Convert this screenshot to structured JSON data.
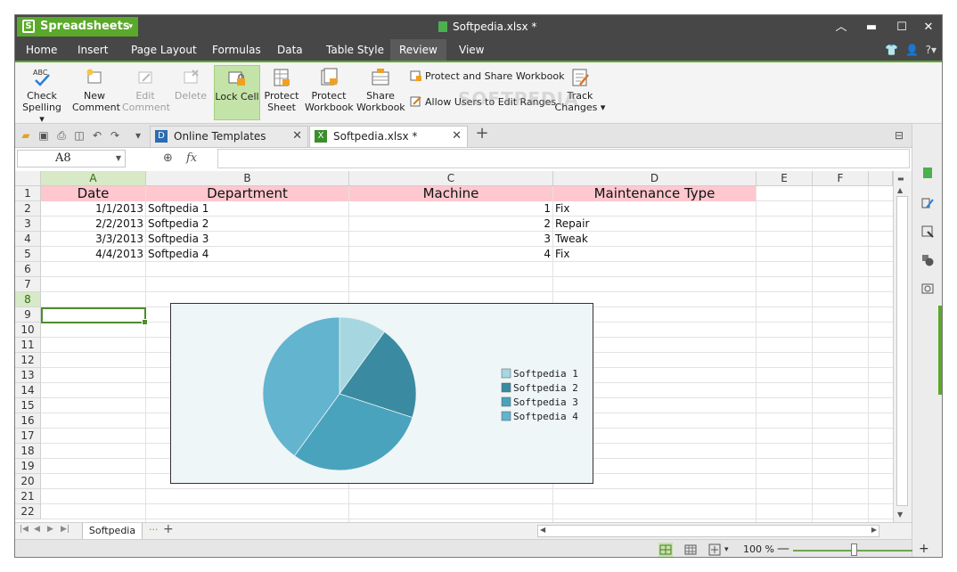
{
  "titlebar": {
    "app_name": "Spreadsheets",
    "doc_title": "Softpedia.xlsx *"
  },
  "menu": [
    "Home",
    "Insert",
    "Page Layout",
    "Formulas",
    "Data",
    "Table Style",
    "Review",
    "View"
  ],
  "menu_active": "Review",
  "ribbon": {
    "check_spelling_1": "Check",
    "check_spelling_2": "Spelling",
    "new_comment_1": "New",
    "new_comment_2": "Comment",
    "edit_comment_1": "Edit",
    "edit_comment_2": "Comment",
    "delete": "Delete",
    "lock_cell": "Lock Cell",
    "protect_sheet_1": "Protect",
    "protect_sheet_2": "Sheet",
    "protect_workbook_1": "Protect",
    "protect_workbook_2": "Workbook",
    "share_workbook_1": "Share",
    "share_workbook_2": "Workbook",
    "protect_share": "Protect and Share Workbook",
    "allow_users": "Allow Users to Edit Ranges",
    "track_changes_1": "Track",
    "track_changes_2": "Changes",
    "watermark": "SOFTPEDIA"
  },
  "tabs": {
    "online_templates": "Online Templates",
    "doc": "Softpedia.xlsx *"
  },
  "formula_bar": {
    "name_box": "A8",
    "fx": "fx",
    "value": ""
  },
  "columns": [
    "A",
    "B",
    "C",
    "D",
    "E",
    "F"
  ],
  "rows": [
    "1",
    "2",
    "3",
    "4",
    "5",
    "6",
    "7",
    "8",
    "9",
    "10",
    "11",
    "12",
    "13",
    "14",
    "15",
    "16",
    "17",
    "18",
    "19",
    "20",
    "21",
    "22"
  ],
  "header_row": {
    "a": "Date",
    "b": "Department",
    "c": "Machine",
    "d": "Maintenance Type"
  },
  "data_rows": [
    {
      "date": "1/1/2013",
      "dept": "Softpedia 1",
      "machine": "1",
      "type": "Fix"
    },
    {
      "date": "2/2/2013",
      "dept": "Softpedia 2",
      "machine": "2",
      "type": "Repair"
    },
    {
      "date": "3/3/2013",
      "dept": "Softpedia 3",
      "machine": "3",
      "type": "Tweak"
    },
    {
      "date": "4/4/2013",
      "dept": "Softpedia 4",
      "machine": "4",
      "type": "Fix"
    }
  ],
  "chart_data": {
    "type": "pie",
    "categories": [
      "Softpedia 1",
      "Softpedia 2",
      "Softpedia 3",
      "Softpedia 4"
    ],
    "values": [
      1,
      2,
      3,
      4
    ],
    "colors": [
      "#a6d6e0",
      "#3a8ba1",
      "#4aa3bd",
      "#62b4cf"
    ],
    "title": "",
    "legend": "right"
  },
  "sheet_tabs": {
    "active": "Softpedia"
  },
  "status": {
    "zoom": "100 %"
  },
  "colors": {
    "accent": "#5aa92a",
    "header_fill": "#ffc7ce",
    "chart_bg": "#eff6f8"
  }
}
